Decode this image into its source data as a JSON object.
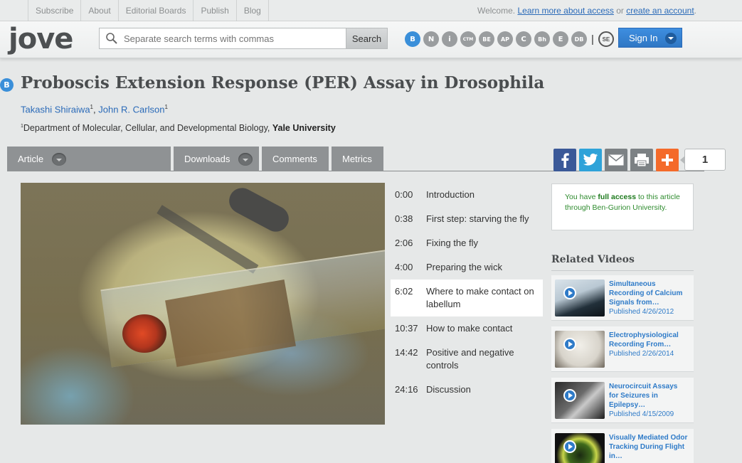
{
  "topnav": {
    "items": [
      "Subscribe",
      "About",
      "Editorial Boards",
      "Publish",
      "Blog"
    ],
    "welcome_prefix": "Welcome.",
    "learn_more": "Learn more about access",
    "or": "or",
    "create_account": "create an account",
    "period": "."
  },
  "header": {
    "logo": "jove",
    "search_placeholder": "Separate search terms with commas",
    "search_button": "Search",
    "sections": [
      "B",
      "N",
      "i",
      "CTM",
      "BE",
      "AP",
      "C",
      "Bh",
      "E",
      "DB"
    ],
    "active_section": "B",
    "separator": "|",
    "se_label": "SE",
    "signin": "Sign In"
  },
  "article": {
    "badge": "B",
    "title": "Proboscis Extension Response (PER) Assay in Drosophila",
    "authors": [
      {
        "name": "Takashi Shiraiwa",
        "sup": "1"
      },
      {
        "name": "John R. Carlson",
        "sup": "1"
      }
    ],
    "author_sep": ", ",
    "affil_sup": "1",
    "affil_text": "Department of Molecular, Cellular, and Developmental Biology, ",
    "affil_inst": "Yale University"
  },
  "tabs": {
    "article": "Article",
    "downloads": "Downloads",
    "comments": "Comments",
    "metrics": "Metrics"
  },
  "share": {
    "count": "1"
  },
  "chapters": [
    {
      "time": "0:00",
      "label": "Introduction"
    },
    {
      "time": "0:38",
      "label": "First step: starving the fly"
    },
    {
      "time": "2:06",
      "label": "Fixing the fly"
    },
    {
      "time": "4:00",
      "label": "Preparing the wick"
    },
    {
      "time": "6:02",
      "label": "Where to make contact on labellum"
    },
    {
      "time": "10:37",
      "label": "How to make contact"
    },
    {
      "time": "14:42",
      "label": "Positive and negative controls"
    },
    {
      "time": "24:16",
      "label": "Discussion"
    }
  ],
  "active_chapter_index": 4,
  "access": {
    "prefix": "You have ",
    "bold": "full access",
    "suffix": " to this article through Ben-Gurion University."
  },
  "related": {
    "heading": "Related Videos",
    "items": [
      {
        "title": "Simultaneous Recording of Calcium Signals from…",
        "date": "Published 4/26/2012"
      },
      {
        "title": "Electrophysiological Recording From…",
        "date": "Published 2/26/2014"
      },
      {
        "title": "Neurocircuit Assays for Seizures in Epilepsy…",
        "date": "Published 4/15/2009"
      },
      {
        "title": "Visually Mediated Odor Tracking During Flight in…",
        "date": ""
      }
    ]
  },
  "colors": {
    "accent": "#2a6ab8",
    "active_section": "#3a8fd9",
    "access_green": "#2e8b2e",
    "facebook": "#3b5998",
    "twitter": "#2fa3d9",
    "addthis": "#f46a2a"
  }
}
